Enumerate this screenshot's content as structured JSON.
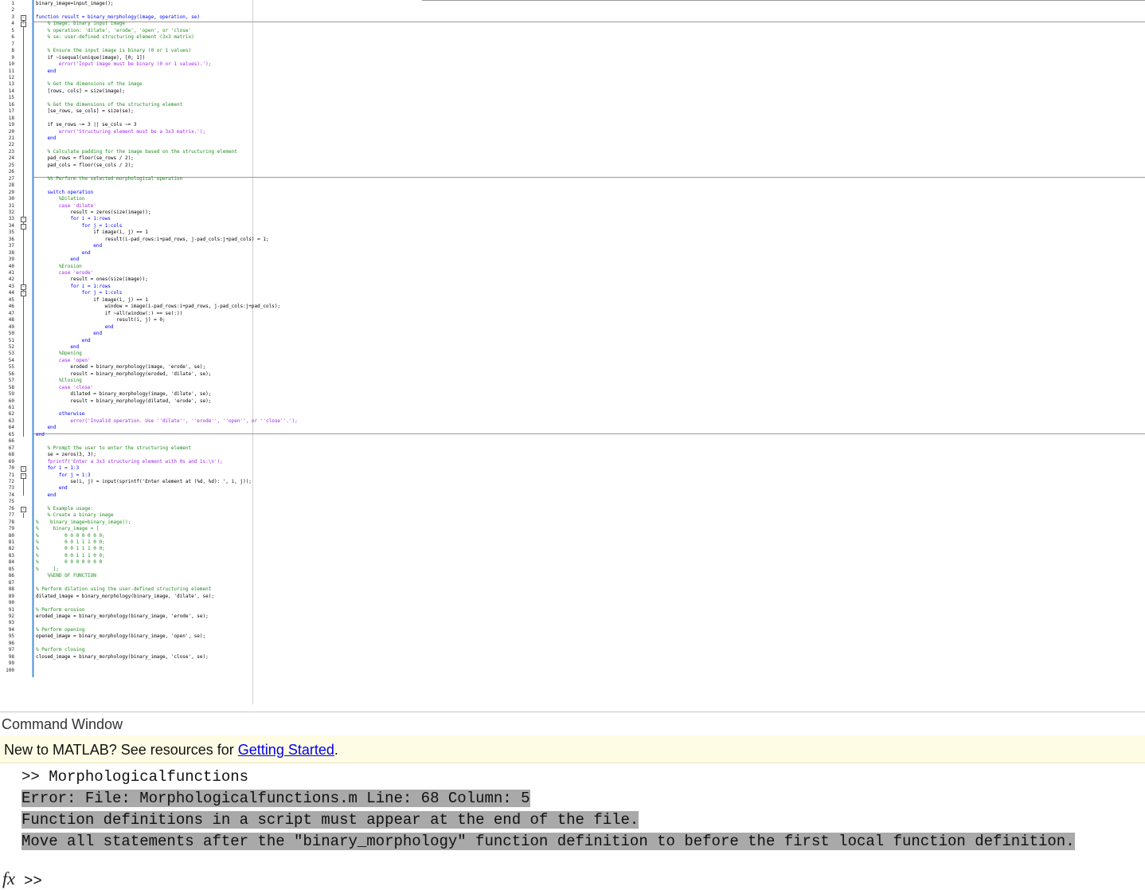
{
  "editor": {
    "line_numbers": [
      "1",
      "2",
      "3",
      "4",
      "5",
      "6",
      "7",
      "8",
      "9",
      "10",
      "11",
      "12",
      "13",
      "14",
      "15",
      "16",
      "17",
      "18",
      "19",
      "20",
      "21",
      "22",
      "23",
      "24",
      "25",
      "26",
      "27",
      "28",
      "29",
      "30",
      "31",
      "32",
      "33",
      "34",
      "35",
      "36",
      "37",
      "38",
      "39",
      "40",
      "41",
      "42",
      "43",
      "44",
      "45",
      "46",
      "47",
      "48",
      "49",
      "50",
      "51",
      "52",
      "53",
      "54",
      "55",
      "56",
      "57",
      "58",
      "59",
      "60",
      "61",
      "62",
      "63",
      "64",
      "65",
      "66",
      "67",
      "68",
      "69",
      "70",
      "71",
      "72",
      "73",
      "74",
      "75",
      "76",
      "77",
      "78",
      "79",
      "80",
      "81",
      "82",
      "83",
      "84",
      "85",
      "86",
      "87",
      "88",
      "89",
      "90",
      "91",
      "92",
      "93",
      "94",
      "95",
      "96",
      "97",
      "98",
      "99",
      "100"
    ],
    "lines": [
      {
        "text": "binary_image=input_image();",
        "type": "code"
      },
      {
        "text": "",
        "type": "code"
      },
      {
        "text": "function result = binary_morphology(image, operation, se)",
        "type": "kw"
      },
      {
        "text": "    % image: binary input image",
        "type": "cm"
      },
      {
        "text": "    % operation: 'dilate', 'erode', 'open', or 'close'",
        "type": "cm"
      },
      {
        "text": "    % se: user-defined structuring element (3x3 matrix)",
        "type": "cm"
      },
      {
        "text": "",
        "type": "code"
      },
      {
        "text": "    % Ensure the input image is binary (0 or 1 values)",
        "type": "cm"
      },
      {
        "text": "    if ~isequal(unique(image), [0; 1])",
        "type": "code"
      },
      {
        "text": "        error('Input image must be binary (0 or 1 values).');",
        "type": "str"
      },
      {
        "text": "    end",
        "type": "kw"
      },
      {
        "text": "",
        "type": "code"
      },
      {
        "text": "    % Get the dimensions of the image",
        "type": "cm"
      },
      {
        "text": "    [rows, cols] = size(image);",
        "type": "code"
      },
      {
        "text": "",
        "type": "code"
      },
      {
        "text": "    % Get the dimensions of the structuring element",
        "type": "cm"
      },
      {
        "text": "    [se_rows, se_cols] = size(se);",
        "type": "code"
      },
      {
        "text": "",
        "type": "code"
      },
      {
        "text": "    if se_rows ~= 3 || se_cols ~= 3",
        "type": "code"
      },
      {
        "text": "        error('Structuring element must be a 3x3 matrix.');",
        "type": "str"
      },
      {
        "text": "    end",
        "type": "kw"
      },
      {
        "text": "",
        "type": "code"
      },
      {
        "text": "    % Calculate padding for the image based on the structuring element",
        "type": "cm"
      },
      {
        "text": "    pad_rows = floor(se_rows / 2);",
        "type": "code"
      },
      {
        "text": "    pad_cols = floor(se_cols / 2);",
        "type": "code"
      },
      {
        "text": "",
        "type": "code"
      },
      {
        "text": "    %% Perform the selected morphological operation",
        "type": "cm"
      },
      {
        "text": "",
        "type": "code"
      },
      {
        "text": "    switch operation",
        "type": "kw"
      },
      {
        "text": "        %Dilation",
        "type": "cm"
      },
      {
        "text": "        case 'dilate'",
        "type": "str"
      },
      {
        "text": "            result = zeros(size(image));",
        "type": "code"
      },
      {
        "text": "            for i = 1:rows",
        "type": "kw"
      },
      {
        "text": "                for j = 1:cols",
        "type": "kw"
      },
      {
        "text": "                    if image(i, j) == 1",
        "type": "code"
      },
      {
        "text": "                        result(i-pad_rows:i+pad_rows, j-pad_cols:j+pad_cols) = 1;",
        "type": "code"
      },
      {
        "text": "                    end",
        "type": "kw"
      },
      {
        "text": "                end",
        "type": "kw"
      },
      {
        "text": "            end",
        "type": "kw"
      },
      {
        "text": "        %Erosion",
        "type": "cm"
      },
      {
        "text": "        case 'erode'",
        "type": "str"
      },
      {
        "text": "            result = ones(size(image));",
        "type": "code"
      },
      {
        "text": "            for i = 1:rows",
        "type": "kw"
      },
      {
        "text": "                for j = 1:cols",
        "type": "kw"
      },
      {
        "text": "                    if image(i, j) == 1",
        "type": "code"
      },
      {
        "text": "                        window = image(i-pad_rows:i+pad_rows, j-pad_cols:j+pad_cols);",
        "type": "code"
      },
      {
        "text": "                        if ~all(window(:) == se(:))",
        "type": "code"
      },
      {
        "text": "                            result(i, j) = 0;",
        "type": "code"
      },
      {
        "text": "                        end",
        "type": "kw"
      },
      {
        "text": "                    end",
        "type": "kw"
      },
      {
        "text": "                end",
        "type": "kw"
      },
      {
        "text": "            end",
        "type": "kw"
      },
      {
        "text": "        %Opening",
        "type": "cm"
      },
      {
        "text": "        case 'open'",
        "type": "str"
      },
      {
        "text": "            eroded = binary_morphology(image, 'erode', se);",
        "type": "code"
      },
      {
        "text": "            result = binary_morphology(eroded, 'dilate', se);",
        "type": "code"
      },
      {
        "text": "        %Closing",
        "type": "cm"
      },
      {
        "text": "        case 'close'",
        "type": "str"
      },
      {
        "text": "            dilated = binary_morphology(image, 'dilate', se);",
        "type": "code"
      },
      {
        "text": "            result = binary_morphology(dilated, 'erode', se);",
        "type": "code"
      },
      {
        "text": "",
        "type": "code"
      },
      {
        "text": "        otherwise",
        "type": "kw"
      },
      {
        "text": "            error('Invalid operation. Use ''dilate'', ''erode'', ''open'', or ''close''.');",
        "type": "str"
      },
      {
        "text": "    end",
        "type": "kw"
      },
      {
        "text": "end",
        "type": "kw"
      },
      {
        "text": "",
        "type": "code"
      },
      {
        "text": "    % Prompt the user to enter the structuring element",
        "type": "cm"
      },
      {
        "text": "    se = zeros(3, 3);",
        "type": "code"
      },
      {
        "text": "    fprintf('Enter a 3x3 structuring element with 0s and 1s:\\n');",
        "type": "str"
      },
      {
        "text": "    for i = 1:3",
        "type": "kw"
      },
      {
        "text": "        for j = 1:3",
        "type": "kw"
      },
      {
        "text": "            se(i, j) = input(sprintf('Enter element at (%d, %d): ', i, j));",
        "type": "code"
      },
      {
        "text": "        end",
        "type": "kw"
      },
      {
        "text": "    end",
        "type": "kw"
      },
      {
        "text": "",
        "type": "code"
      },
      {
        "text": "    % Example usage:",
        "type": "cm"
      },
      {
        "text": "    % Create a binary image",
        "type": "cm"
      },
      {
        "text": "%    binary_image=binary_image();",
        "type": "cm"
      },
      {
        "text": "%     binary_image = [",
        "type": "cm"
      },
      {
        "text": "%         0 0 0 0 0 0 0;",
        "type": "cm"
      },
      {
        "text": "%         0 0 1 1 1 0 0;",
        "type": "cm"
      },
      {
        "text": "%         0 0 1 1 1 0 0;",
        "type": "cm"
      },
      {
        "text": "%         0 0 1 1 1 0 0;",
        "type": "cm"
      },
      {
        "text": "%         0 0 0 0 0 0 0",
        "type": "cm"
      },
      {
        "text": "%     ];",
        "type": "cm"
      },
      {
        "text": "    %%END OF FUNCTION",
        "type": "cm"
      },
      {
        "text": "",
        "type": "code"
      },
      {
        "text": "% Perform dilation using the user-defined structuring element",
        "type": "cm"
      },
      {
        "text": "dilated_image = binary_morphology(binary_image, 'dilate', se);",
        "type": "code"
      },
      {
        "text": "",
        "type": "code"
      },
      {
        "text": "% Perform erosion",
        "type": "cm"
      },
      {
        "text": "eroded_image = binary_morphology(binary_image, 'erode', se);",
        "type": "code"
      },
      {
        "text": "",
        "type": "code"
      },
      {
        "text": "% Perform opening",
        "type": "cm"
      },
      {
        "text": "opened_image = binary_morphology(binary_image, 'open', se);",
        "type": "code"
      },
      {
        "text": "",
        "type": "code"
      },
      {
        "text": "% Perform closing",
        "type": "cm"
      },
      {
        "text": "closed_image = binary_morphology(binary_image, 'close', se);",
        "type": "code"
      },
      {
        "text": "",
        "type": "code"
      }
    ],
    "fold_lines": [
      3,
      4,
      33,
      34,
      43,
      44,
      70,
      71,
      76
    ]
  },
  "command_window": {
    "title": "Command Window",
    "banner_prefix": "New to MATLAB? See resources for ",
    "banner_link": "Getting Started",
    "banner_suffix": ".",
    "command": ">> Morphologicalfunctions",
    "error_lines": [
      "Error: File: Morphologicalfunctions.m Line: 68 Column: 5",
      "Function definitions in a script must appear at the end of the file.",
      "Move all statements after the \"binary_morphology\" function definition to before the first local function definition."
    ],
    "fx_label": "fx",
    "prompt": ">>"
  }
}
